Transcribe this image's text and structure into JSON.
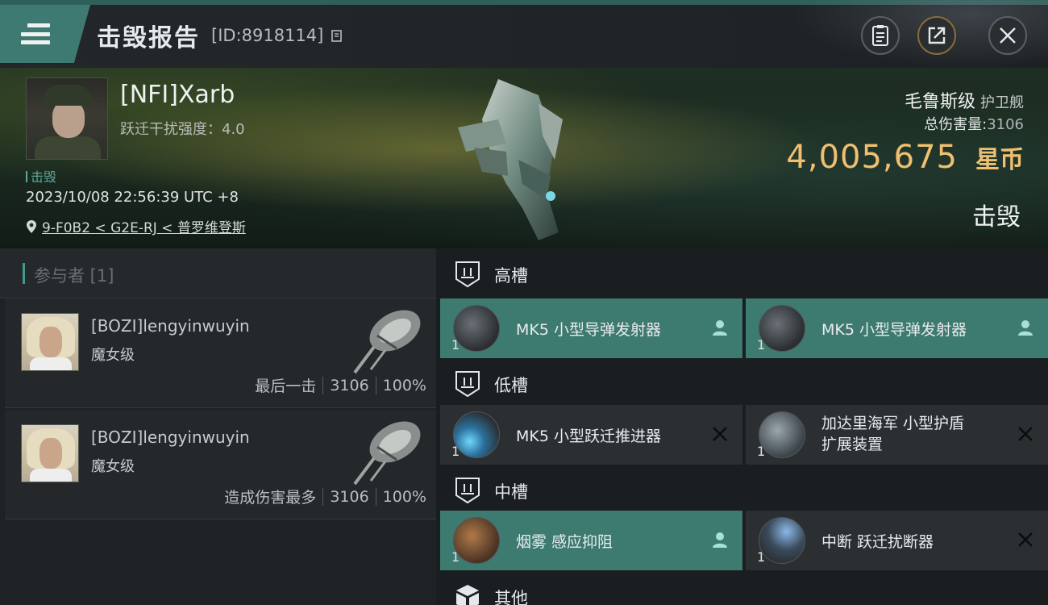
{
  "header": {
    "title": "击毁报告",
    "id_text": "[ID:8918114]",
    "buttons": {
      "clipboard": "clipboard-icon",
      "share": "share-icon",
      "close": "close-icon"
    }
  },
  "victim": {
    "name": "[NFI]Xarb",
    "warp_strength_label": "跃迁干扰强度：4.0",
    "status_tag": "击毁",
    "datetime": "2023/10/08 22:56:39 UTC +8",
    "location": "9-F0B2 < G2E-RJ < 普罗维登斯",
    "ship_name": "毛鲁斯级",
    "ship_type": "护卫舰",
    "total_damage_label": "总伤害量:",
    "total_damage_value": "3106",
    "isk_value": "4,005,675",
    "isk_unit": "星币",
    "result": "击毁"
  },
  "participants": {
    "header": "参与者 [1]",
    "items": [
      {
        "name": "[BOZI]lengyinwuyin",
        "ship": "魔女级",
        "role": "最后一击",
        "damage": "3106",
        "percent": "100%"
      },
      {
        "name": "[BOZI]lengyinwuyin",
        "ship": "魔女级",
        "role": "造成伤害最多",
        "damage": "3106",
        "percent": "100%"
      }
    ]
  },
  "fitting": {
    "high": {
      "label": "高槽",
      "modules": [
        {
          "name": "MK5 小型导弹发射器",
          "qty": "1",
          "state": "fitted"
        },
        {
          "name": "MK5 小型导弹发射器",
          "qty": "1",
          "state": "fitted"
        }
      ]
    },
    "low": {
      "label": "低槽",
      "modules": [
        {
          "name": "MK5 小型跃迁推进器",
          "qty": "1",
          "state": "destroyed"
        },
        {
          "name_line1": "加达里海军 小型护盾",
          "name_line2": "扩展装置",
          "qty": "1",
          "state": "destroyed"
        }
      ]
    },
    "mid": {
      "label": "中槽",
      "modules": [
        {
          "name": "烟雾 感应抑阻",
          "qty": "1",
          "state": "fitted"
        },
        {
          "name": "中断 跃迁扰断器",
          "qty": "1",
          "state": "destroyed"
        }
      ]
    },
    "other": {
      "label": "其他"
    }
  },
  "colors": {
    "accent": "#3d7a6f",
    "isk_gold": "#f0c070",
    "panel": "#2b2f32"
  }
}
